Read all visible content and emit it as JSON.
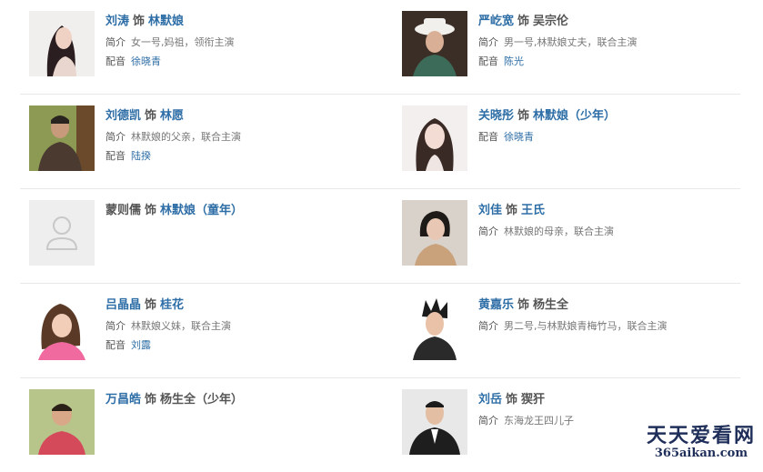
{
  "separator": "饰",
  "labels": {
    "intro": "简介",
    "voice": "配音"
  },
  "cast": [
    {
      "actor": "刘涛",
      "role": "林默娘",
      "intro": "女一号,妈祖，领衔主演",
      "voice": "徐晓青"
    },
    {
      "actor": "严屹宽",
      "role": "吴宗伦",
      "intro": "男一号,林默娘丈夫，联合主演",
      "voice": "陈光"
    },
    {
      "actor": "刘德凯",
      "role": "林愿",
      "intro": "林默娘的父亲，联合主演",
      "voice": "陆揆"
    },
    {
      "actor": "关晓彤",
      "role": "林默娘（少年）",
      "voice": "徐晓青"
    },
    {
      "actor": "蒙则儒",
      "role": "林默娘（童年）"
    },
    {
      "actor": "刘佳",
      "role": "王氏",
      "intro": "林默娘的母亲，联合主演"
    },
    {
      "actor": "吕晶晶",
      "role": "桂花",
      "intro": "林默娘义妹，联合主演",
      "voice": "刘露"
    },
    {
      "actor": "黄嘉乐",
      "role": "杨生全",
      "intro": "男二号,与林默娘青梅竹马，联合主演"
    },
    {
      "actor": "万昌皓",
      "role": "杨生全（少年）"
    },
    {
      "actor": "刘岳",
      "role": "猰犴",
      "intro": "东海龙王四儿子"
    }
  ],
  "watermark": {
    "text": "天天爱看网",
    "url": "365aikan.com"
  }
}
